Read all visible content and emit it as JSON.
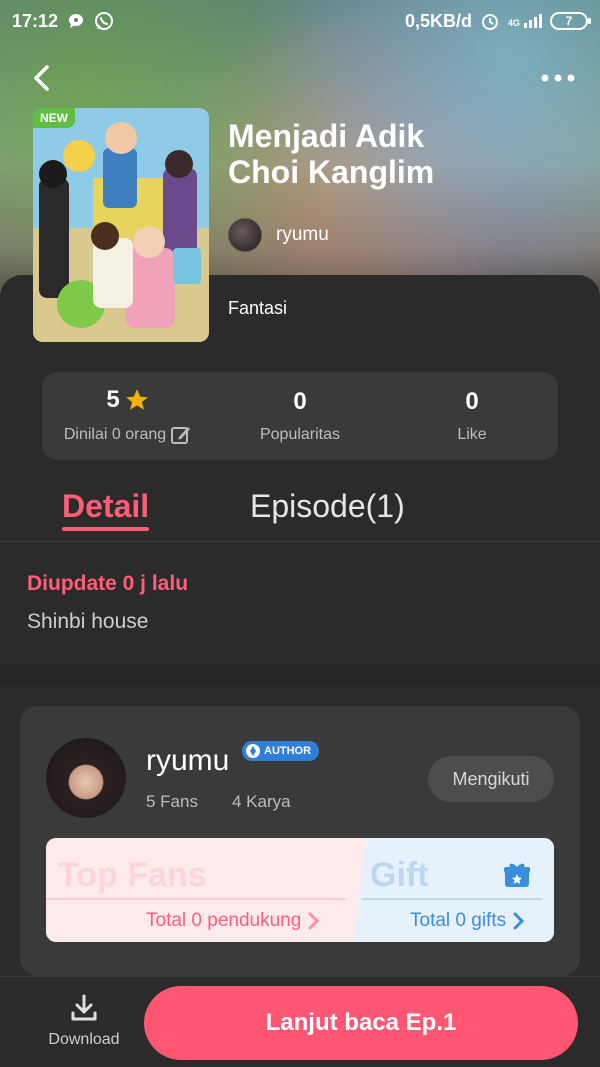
{
  "status_bar": {
    "time": "17:12",
    "network_speed": "0,5KB/d",
    "signal": "4G",
    "battery": "7"
  },
  "comic": {
    "badge": "NEW",
    "title_line1": "Menjadi Adik",
    "title_line2": "Choi Kanglim",
    "author": "ryumu",
    "genre": "Fantasi"
  },
  "stats": {
    "rating": "5",
    "rating_label": "Dinilai 0 orang",
    "popularity": "0",
    "popularity_label": "Popularitas",
    "likes": "0",
    "likes_label": "Like"
  },
  "tabs": {
    "detail": "Detail",
    "episode": "Episode(1)"
  },
  "detail": {
    "updated": "Diupdate 0 j lalu",
    "publisher": "Shinbi house"
  },
  "author_card": {
    "name": "ryumu",
    "badge": "AUTHOR",
    "fans": "5 Fans",
    "works": "4 Karya",
    "follow_label": "Mengikuti",
    "top_fans_title": "Top Fans",
    "top_fans_link": "Total 0 pendukung",
    "gift_title": "Gift",
    "gift_link": "Total 0 gifts"
  },
  "bottom_bar": {
    "download_label": "Download",
    "read_button": "Lanjut baca Ep.1"
  },
  "colors": {
    "accent": "#ff5e79",
    "read_button": "#ff5673",
    "gift_blue": "#3a8ede",
    "author_badge": "#2f7fd8",
    "background": "#2b2b2b"
  }
}
